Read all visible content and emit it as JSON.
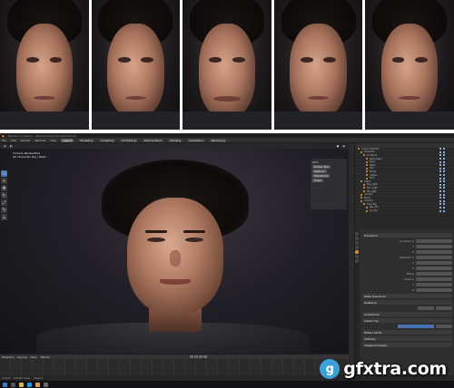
{
  "window": {
    "title": "Blender [C:\\Users\\...\\Expressions\\Character.blend]"
  },
  "menus": [
    "File",
    "Edit",
    "Render",
    "Window",
    "Help"
  ],
  "workspace_tabs": [
    "Layout",
    "Modeling",
    "Sculpting",
    "UV Editing",
    "Texture Paint",
    "Shading",
    "Animation",
    "Rendering"
  ],
  "viewport": {
    "info_lines": [
      "Camera Perspective",
      "(0) Character Rig | Head"
    ],
    "npanel_title": "Item",
    "npanel_rows": [
      "Active Tool",
      "Options",
      "Transform",
      "Snap"
    ]
  },
  "outliner": {
    "rows": [
      "Scene Collection",
      "Character",
      "Armature",
      "Head_Mesh",
      "Eyes",
      "Teeth",
      "Hair",
      "Brows",
      "Lashes",
      "Shirt",
      "Lights",
      "Key_Light",
      "Rim_Light",
      "Fill_Light",
      "Camera",
      "World",
      "Controls",
      "Face_Rig",
      "Jaw_Ctrl",
      "Lip_Ctrl"
    ]
  },
  "properties": {
    "sections": [
      "Transform",
      "Delta Transform",
      "Relations",
      "Collections",
      "Instancing",
      "Motion Paths",
      "Visibility",
      "Viewport Display"
    ],
    "labels": [
      "Location X",
      "Y",
      "Z",
      "Rotation X",
      "Y",
      "Z",
      "Mode",
      "Scale X",
      "Y",
      "Z"
    ]
  },
  "timeline": {
    "menus": [
      "Playback",
      "Keying",
      "View",
      "Marker"
    ]
  },
  "statusbar": {
    "left": "Select",
    "mid": "Rotate View",
    "right": "Object"
  },
  "watermark": {
    "logo_letter": "g",
    "text": "gfxtra.com"
  },
  "colors": {
    "accent_blue": "#4772b3",
    "accent_orange": "#e89a3c",
    "bg_dark": "#2b2b2b"
  }
}
